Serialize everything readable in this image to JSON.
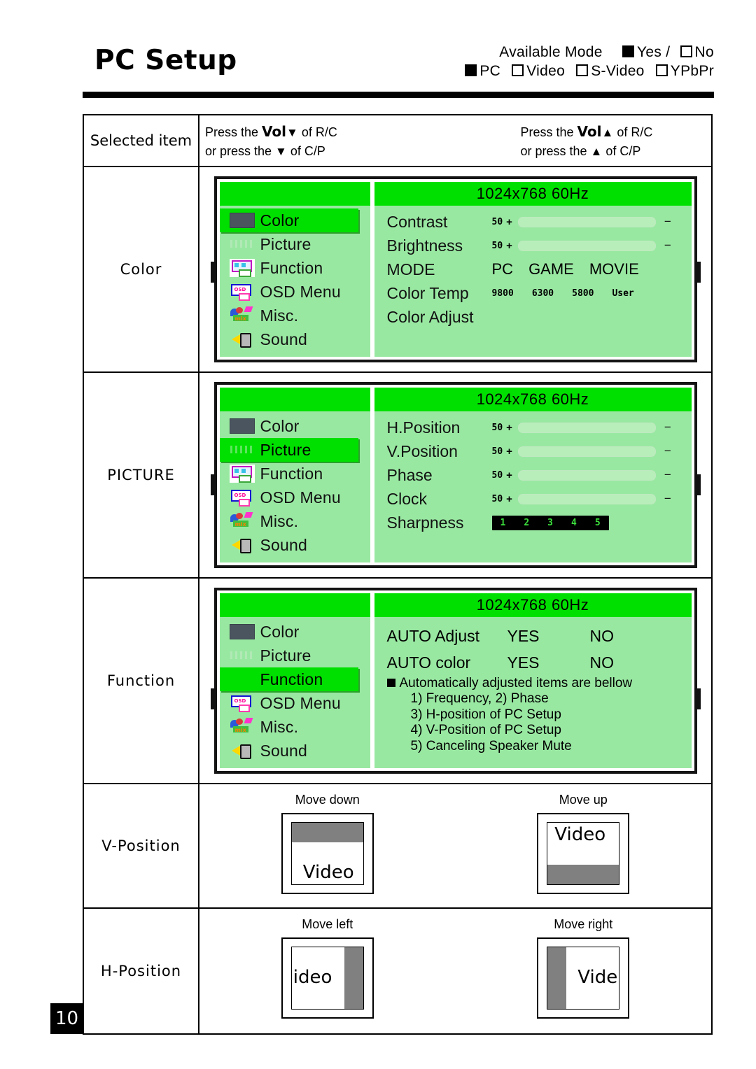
{
  "header": {
    "title": "PC Setup",
    "available_mode_label": "Available Mode",
    "yes_label": "Yes /",
    "no_label": "No",
    "sources": [
      {
        "label": "PC",
        "checked": true
      },
      {
        "label": "Video",
        "checked": false
      },
      {
        "label": "S-Video",
        "checked": false
      },
      {
        "label": "YPbPr",
        "checked": false
      }
    ]
  },
  "table_head": {
    "selected_item": "Selected item",
    "down_line1": "Press the Vol▼ of R/C",
    "down_line2": "or press the ▼ of C/P",
    "down_vol": "Vol",
    "up_line1": "Press the Vol▲ of R/C",
    "up_line2": "or press the ▲ of C/P",
    "up_vol": "Vol"
  },
  "rows": {
    "color": {
      "label": "Color"
    },
    "picture": {
      "label": "PICTURE"
    },
    "function": {
      "label": "Function"
    },
    "vposition": {
      "label": "V-Position"
    },
    "hposition": {
      "label": "H-Position"
    }
  },
  "osd": {
    "resolution": "1024x768  60Hz",
    "menu": [
      {
        "label": "Color",
        "icon": "color-swatch-icon"
      },
      {
        "label": "Picture",
        "icon": "picture-bars-icon"
      },
      {
        "label": "Function",
        "icon": "function-monitor-icon"
      },
      {
        "label": "OSD Menu",
        "icon": "osd-monitor-icon"
      },
      {
        "label": "Misc.",
        "icon": "misc-flower-icon"
      },
      {
        "label": "Sound",
        "icon": "speaker-icon"
      }
    ],
    "color_panel": {
      "selected": "Color",
      "items": [
        {
          "label": "Contrast",
          "type": "slider",
          "value": "50",
          "fill": 50
        },
        {
          "label": "Brightness",
          "type": "slider",
          "value": "50",
          "fill": 50
        },
        {
          "label": "MODE",
          "type": "options",
          "options": [
            "PC",
            "GAME",
            "MOVIE"
          ]
        },
        {
          "label": "Color Temp",
          "type": "small-options",
          "options": [
            "9800",
            "6300",
            "5800",
            "User"
          ]
        },
        {
          "label": "Color Adjust",
          "type": "plain"
        }
      ],
      "plus": "+",
      "minus": "−"
    },
    "picture_panel": {
      "selected": "Picture",
      "items": [
        {
          "label": "H.Position",
          "type": "slider",
          "value": "50",
          "fill": 50
        },
        {
          "label": "V.Position",
          "type": "slider",
          "value": "50",
          "fill": 50
        },
        {
          "label": "Phase",
          "type": "slider",
          "value": "50",
          "fill": 50
        },
        {
          "label": "Clock",
          "type": "slider",
          "value": "50",
          "fill": 50
        },
        {
          "label": "Sharpness",
          "type": "steps",
          "steps": [
            "1",
            "2",
            "3",
            "4",
            "5"
          ]
        }
      ],
      "plus": "+",
      "minus": "−"
    },
    "function_panel": {
      "selected": "Function",
      "auto_adjust": {
        "label": "AUTO Adjust",
        "yes": "YES",
        "no": "NO"
      },
      "auto_color": {
        "label": "AUTO color",
        "yes": "YES",
        "no": "NO"
      },
      "note_title": "Automatically adjusted items are bellow",
      "note_items": [
        "1) Frequency,    2) Phase",
        "3) H-position of PC Setup",
        "4) V-Position of PC Setup",
        "5) Canceling Speaker Mute"
      ]
    }
  },
  "vposition": {
    "down_caption": "Move down",
    "up_caption": "Move up",
    "video_label": "Video"
  },
  "hposition": {
    "left_caption": "Move left",
    "right_caption": "Move right",
    "left_label": "ideo",
    "right_label": "Vide"
  },
  "page_number": "10",
  "colors": {
    "osd_header_green": "#00e000",
    "osd_body_green": "#99e8a2",
    "slider_fill": "#5cf05c",
    "gray_block": "#808080"
  }
}
